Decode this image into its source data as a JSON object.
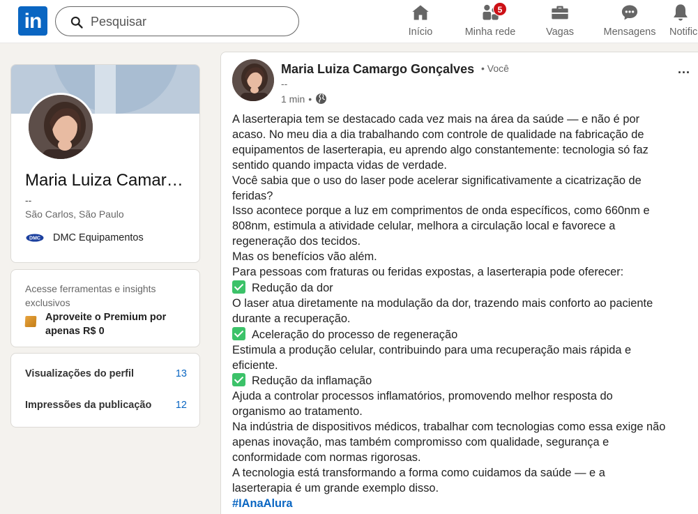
{
  "brand": {
    "logo_text": "in",
    "accent": "#0a66c2"
  },
  "search": {
    "placeholder": "Pesquisar"
  },
  "nav": {
    "items": [
      {
        "label": "Início",
        "icon": "home-icon"
      },
      {
        "label": "Minha rede",
        "icon": "my-network-icon",
        "badge": "5"
      },
      {
        "label": "Vagas",
        "icon": "briefcase-icon"
      },
      {
        "label": "Mensagens",
        "icon": "messaging-icon"
      },
      {
        "label": "Notific",
        "icon": "bell-icon"
      }
    ]
  },
  "profile": {
    "name": "Maria Luiza Camargo Gonçalves",
    "headline": "--",
    "location": "São Carlos, São Paulo",
    "company": "DMC Equipamentos",
    "company_logo_text": "DMC"
  },
  "premium": {
    "text": "Acesse ferramentas e insights exclusivos",
    "link": "Aproveite o Premium por apenas R$ 0"
  },
  "stats": [
    {
      "label": "Visualizações do perfil",
      "value": "13"
    },
    {
      "label": "Impressões da publicação",
      "value": "12"
    }
  ],
  "post": {
    "author": "Maria Luiza Camargo Gonçalves",
    "you_label": "• Você",
    "headline": "--",
    "time": "1 min",
    "time_dot": "•",
    "more": "...",
    "lines": [
      "A laserterapia tem se destacado cada vez mais na área da saúde — e não é por",
      "acaso. No meu dia a dia trabalhando com controle de qualidade na fabricação de",
      "equipamentos de laserterapia, eu aprendo algo constantemente: tecnologia só faz",
      "sentido quando impacta vidas de verdade.",
      "Você sabia que o uso do laser pode acelerar significativamente a cicatrização de",
      "feridas?",
      "Isso acontece porque a luz em comprimentos de onda específicos, como 660nm e",
      "808nm, estimula a atividade celular, melhora a circulação local e favorece a",
      "regeneração dos tecidos.",
      "Mas os benefícios vão além.",
      "Para pessoas com fraturas ou feridas expostas, a laserterapia pode oferecer:",
      "Redução da dor",
      "O laser atua diretamente na modulação da dor, trazendo mais conforto ao paciente",
      "durante a recuperação.",
      "Aceleração do processo de regeneração",
      "Estimula a produção celular, contribuindo para uma recuperação mais rápida e",
      "eficiente.",
      "Redução da inflamação",
      "Ajuda a controlar processos inflamatórios, promovendo melhor resposta do",
      "organismo ao tratamento.",
      "Na indústria de dispositivos médicos, trabalhar com tecnologias como essa exige não",
      "apenas inovação, mas também compromisso com qualidade, segurança e",
      "conformidade com normas rigorosas.",
      "A tecnologia está transformando a forma como cuidamos da saúde — e a",
      "laserterapia é um grande exemplo disso."
    ],
    "check_lines": [
      11,
      14,
      17
    ],
    "hashtag": "#IAnaAlura"
  }
}
